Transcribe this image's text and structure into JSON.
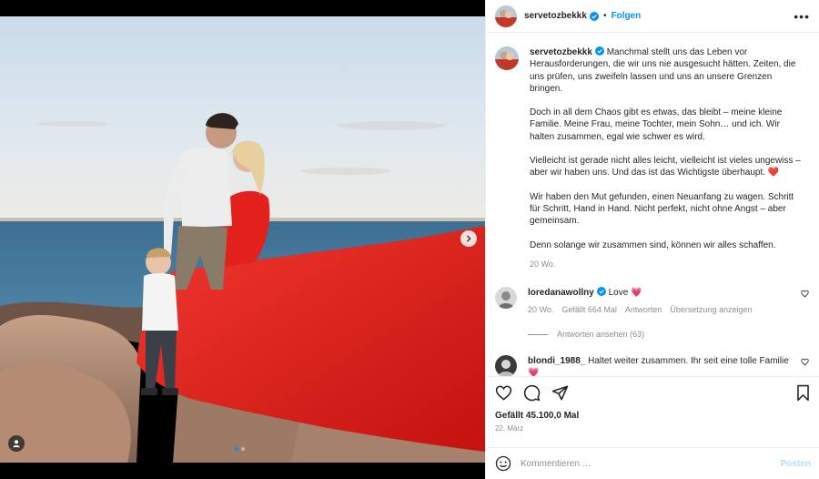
{
  "post": {
    "username": "servetozbekkk",
    "separator": "•",
    "follow_label": "Folgen",
    "more_label": "•••",
    "caption_paragraphs": [
      "Manchmal stellt uns das Leben vor Herausforderungen, die wir uns nie ausgesucht hätten. Zeiten, die uns prüfen, uns zweifeln lassen und uns an unsere Grenzen bringen.",
      "Doch in all dem Chaos gibt es etwas, das bleibt – meine kleine Familie. Meine Frau, meine Tochter, mein Sohn… und ich. Wir halten zusammen, egal wie schwer es wird.",
      "Vielleicht ist gerade nicht alles leicht, vielleicht ist vieles ungewiss – aber wir haben uns. Und das ist das Wichtigste überhaupt. ❤️",
      "Wir haben den Mut gefunden, einen Neuanfang zu wagen. Schritt für Schritt, Hand in Hand. Nicht perfekt, nicht ohne Angst – aber gemeinsam.",
      "Denn solange wir zusammen sind, können wir alles schaffen."
    ],
    "caption_time": "20 Wo.",
    "likes": "Gefällt 45.100,0 Mal",
    "date": "22. März"
  },
  "comments": [
    {
      "username": "loredanawollny",
      "text": "Love 💗",
      "time": "20 Wo.",
      "likes": "Gefällt 664 Mal",
      "reply_label": "Antworten",
      "translate_label": "Übersetzung anzeigen",
      "view_replies": "Antworten ansehen (63)"
    },
    {
      "username": "blondi_1988_",
      "text": "Haltet weiter zusammen. Ihr seit eine tolle Familie 💗"
    }
  ],
  "composer": {
    "placeholder": "Kommentieren …",
    "post_label": "Posten"
  },
  "media": {
    "total_slides": 2,
    "active_slide": 1
  },
  "colors": {
    "accent": "#0095f6",
    "heart": "#ed4956",
    "dress": "#e3211c"
  }
}
